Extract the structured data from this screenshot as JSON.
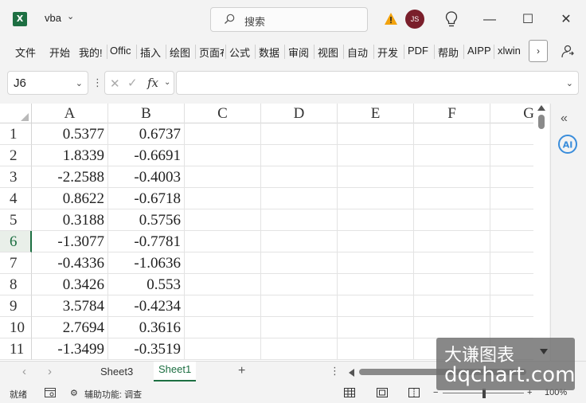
{
  "titlebar": {
    "app_icon": "excel-icon",
    "doc_name": "vba",
    "search_placeholder": "搜索",
    "avatar_initials": "JS",
    "window_buttons": [
      "minimize",
      "maximize",
      "close"
    ]
  },
  "ribbon": {
    "tabs": [
      "文件",
      "开始",
      "我的!",
      "Offic",
      "插入",
      "绘图",
      "页面布",
      "公式",
      "数据",
      "审阅",
      "视图",
      "自动",
      "开发",
      "PDF",
      "帮助",
      "AIPP",
      "xlwin"
    ],
    "more_label": "›"
  },
  "formula_bar": {
    "name_box": "J6",
    "fx_label": "fx",
    "formula": ""
  },
  "grid": {
    "columns": [
      "A",
      "B",
      "C",
      "D",
      "E",
      "F",
      "G"
    ],
    "rows": [
      {
        "num": "1",
        "a": "0.5377",
        "b": "0.6737"
      },
      {
        "num": "2",
        "a": "1.8339",
        "b": "-0.6691"
      },
      {
        "num": "3",
        "a": "-2.2588",
        "b": "-0.4003"
      },
      {
        "num": "4",
        "a": "0.8622",
        "b": "-0.6718"
      },
      {
        "num": "5",
        "a": "0.3188",
        "b": "0.5756"
      },
      {
        "num": "6",
        "a": "-1.3077",
        "b": "-0.7781"
      },
      {
        "num": "7",
        "a": "-0.4336",
        "b": "-1.0636"
      },
      {
        "num": "8",
        "a": "0.3426",
        "b": "0.553"
      },
      {
        "num": "9",
        "a": "3.5784",
        "b": "-0.4234"
      },
      {
        "num": "10",
        "a": "2.7694",
        "b": "0.3616"
      },
      {
        "num": "11",
        "a": "-1.3499",
        "b": "-0.3519"
      }
    ],
    "active_row": "6"
  },
  "sheets": {
    "tabs": [
      "Sheet3",
      "Sheet1"
    ],
    "active": "Sheet1",
    "add_label": "+"
  },
  "statusbar": {
    "ready": "就绪",
    "accessibility": "辅助功能: 调查",
    "zoom": "100%",
    "zoom_minus": "−",
    "zoom_plus": "+"
  },
  "watermark": {
    "cn": "大谦图表",
    "en": "dqchart.com"
  },
  "colors": {
    "accent": "#1d6f42",
    "avatar": "#7a1f2b"
  }
}
